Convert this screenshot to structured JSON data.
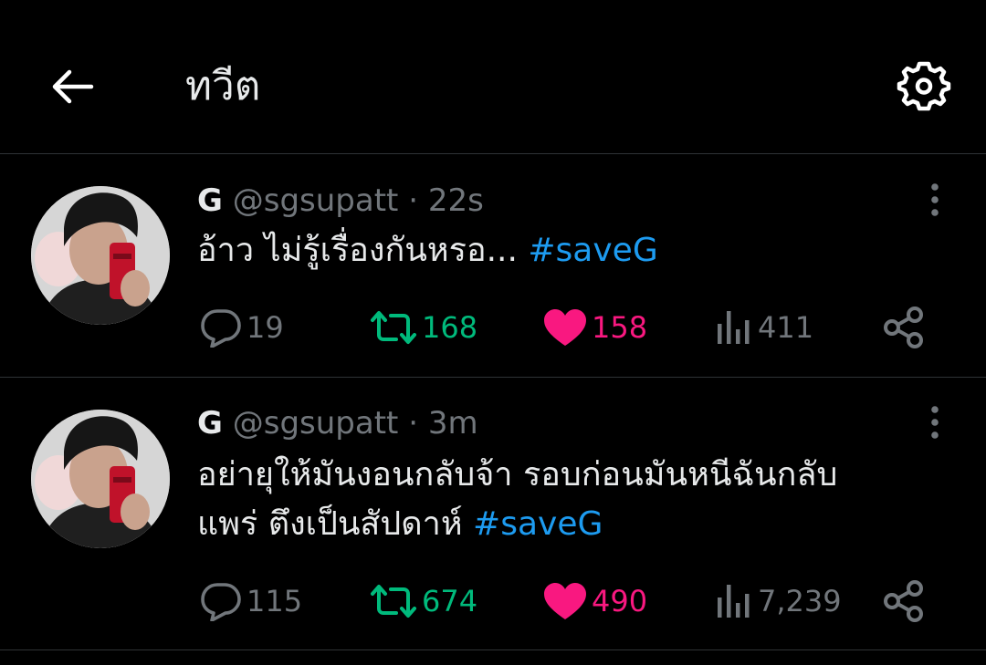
{
  "header": {
    "title": "ทวีต",
    "back_icon": "arrow-left-icon",
    "settings_icon": "gear-icon"
  },
  "colors": {
    "background": "#000000",
    "text": "#e7e9ea",
    "muted": "#71767b",
    "link": "#1d9bf0",
    "retweet": "#00ba7c",
    "like": "#f91880",
    "divider": "#2f3336"
  },
  "tweets": [
    {
      "name": "G",
      "handle": "@sgsupatt",
      "dot": "·",
      "time": "22s",
      "text": "อ้าว ไม่รู้เรื่องกันหรอ...",
      "hashtag": "#saveG",
      "replies": "19",
      "retweets": "168",
      "likes": "158",
      "views": "411",
      "liked": true,
      "retweeted": true
    },
    {
      "name": "G",
      "handle": "@sgsupatt",
      "dot": "·",
      "time": "3m",
      "text_line1": "อย่ายุให้มันงอนกลับจ้า รอบก่อนมันหนีฉันกลับ",
      "text_line2": "แพร่ ตึงเป็นสัปดาห์",
      "hashtag": "#saveG",
      "replies": "115",
      "retweets": "674",
      "likes": "490",
      "views": "7,239",
      "liked": true,
      "retweeted": true
    }
  ]
}
